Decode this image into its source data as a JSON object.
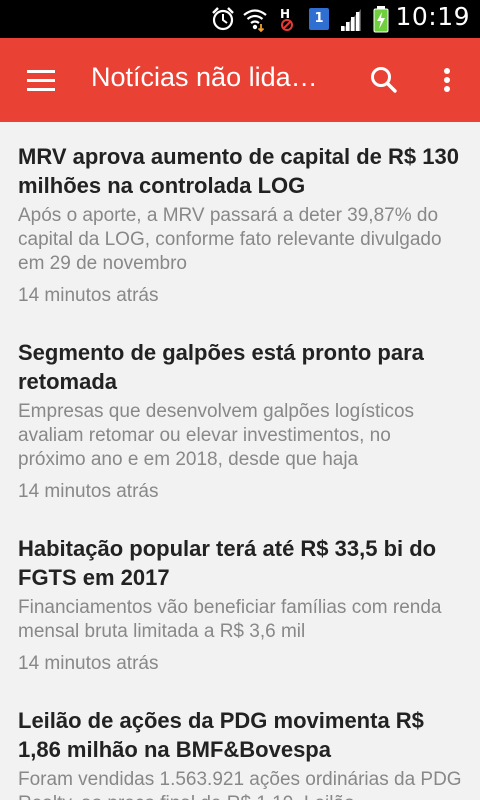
{
  "status_bar": {
    "time": "10:19",
    "sim_label": "1",
    "icons": [
      "alarm-icon",
      "wifi-icon",
      "h-signal-icon",
      "sim-1-icon",
      "signal-bars-icon",
      "battery-charging-icon"
    ],
    "battery_color": "#6fcf3d"
  },
  "app_bar": {
    "title": "Notícias não lida…",
    "background": "#e94235"
  },
  "articles": [
    {
      "title": "MRV aprova aumento de capital de R$ 130 milhões na controlada LOG",
      "summary": "Após o aporte, a MRV passará a deter 39,87% do capital da LOG, conforme fato relevante divulgado em 29 de novembro",
      "time": "14 minutos atrás"
    },
    {
      "title": "Segmento de galpões está pronto para retomada",
      "summary": "Empresas que desenvolvem galpões logísticos avaliam retomar ou elevar investimentos, no próximo ano e em 2018, desde que haja",
      "time": "14 minutos atrás"
    },
    {
      "title": "Habitação popular terá até R$ 33,5 bi do FGTS em 2017",
      "summary": "Financiamentos vão beneficiar famílias com renda mensal bruta limitada a R$ 3,6 mil",
      "time": "14 minutos atrás"
    },
    {
      "title": "Leilão de ações da PDG movimenta R$ 1,86 milhão na BMF&Bovespa",
      "summary": "Foram vendidas 1.563.921 ações ordinárias da PDG Realty, ao preço final de R$ 1,19. Leilão",
      "time": ""
    }
  ]
}
